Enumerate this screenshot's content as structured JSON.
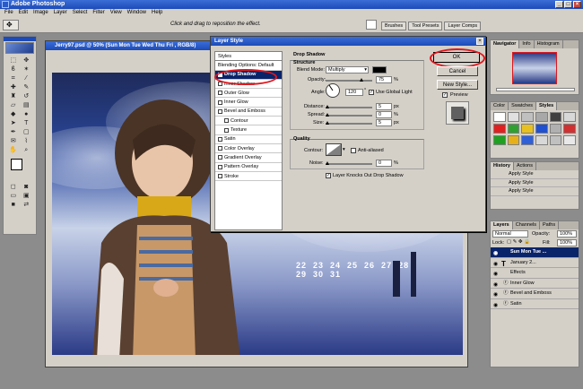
{
  "app": {
    "title": "Adobe Photoshop"
  },
  "menu": [
    "File",
    "Edit",
    "Image",
    "Layer",
    "Select",
    "Filter",
    "View",
    "Window",
    "Help"
  ],
  "options": {
    "hint": "Click and drag to reposition the effect.",
    "wells": [
      "Brushes",
      "Tool Presets",
      "Layer Comps"
    ]
  },
  "document": {
    "title": "Jerry97.psd @ 50% (Sun Mon Tue Wed Thu Fri , RGB/8)"
  },
  "calendar": {
    "row1": "22  23  24  25  26  27  28",
    "row2": "29  30  31"
  },
  "dialog": {
    "title": "Layer Style",
    "styles_header": "Styles",
    "styles": [
      {
        "label": "Blending Options: Default",
        "checked": false,
        "sub": false
      },
      {
        "label": "Drop Shadow",
        "checked": true,
        "sub": false,
        "selected": true
      },
      {
        "label": "Inner Shadow",
        "checked": false,
        "sub": false
      },
      {
        "label": "Outer Glow",
        "checked": false,
        "sub": false
      },
      {
        "label": "Inner Glow",
        "checked": false,
        "sub": false
      },
      {
        "label": "Bevel and Emboss",
        "checked": false,
        "sub": false
      },
      {
        "label": "Contour",
        "checked": false,
        "sub": true
      },
      {
        "label": "Texture",
        "checked": false,
        "sub": true
      },
      {
        "label": "Satin",
        "checked": false,
        "sub": false
      },
      {
        "label": "Color Overlay",
        "checked": false,
        "sub": false
      },
      {
        "label": "Gradient Overlay",
        "checked": false,
        "sub": false
      },
      {
        "label": "Pattern Overlay",
        "checked": false,
        "sub": false
      },
      {
        "label": "Stroke",
        "checked": false,
        "sub": false
      }
    ],
    "section": "Drop Shadow",
    "structure": "Structure",
    "blend_mode_label": "Blend Mode:",
    "blend_mode": "Multiply",
    "opacity_label": "Opacity:",
    "opacity": "75",
    "angle_label": "Angle:",
    "angle": "120",
    "global_light": "Use Global Light",
    "distance_label": "Distance:",
    "distance": "5",
    "spread_label": "Spread:",
    "spread": "0",
    "size_label": "Size:",
    "size": "5",
    "px": "px",
    "pct": "%",
    "quality": "Quality",
    "contour_label": "Contour:",
    "anti_aliased": "Anti-aliased",
    "noise_label": "Noise:",
    "noise": "0",
    "knockout": "Layer Knocks Out Drop Shadow",
    "ok": "OK",
    "cancel": "Cancel",
    "new_style": "New Style...",
    "preview": "Preview",
    "shadow_color": "#000000"
  },
  "navigator": {
    "tabs": [
      "Navigator",
      "Info",
      "Histogram"
    ]
  },
  "styles_panel": {
    "tabs": [
      "Color",
      "Swatches",
      "Styles"
    ]
  },
  "history": {
    "tabs": [
      "History",
      "Actions"
    ],
    "items": [
      "Apply Style",
      "Apply Style",
      "Apply Style"
    ]
  },
  "layers": {
    "tabs": [
      "Layers",
      "Channels",
      "Paths"
    ],
    "mode": "Normal",
    "opacity_label": "Opacity:",
    "opacity": "100%",
    "lock_label": "Lock:",
    "fill_label": "Fill:",
    "fill": "100%",
    "rows": [
      {
        "label": "Sun Mon Tue ...",
        "kind": "text",
        "selected": true
      },
      {
        "label": "January 2...",
        "kind": "text",
        "selected": false
      },
      {
        "label": "Effects",
        "kind": "effects",
        "selected": false
      },
      {
        "label": "Inner Glow",
        "kind": "effect",
        "selected": false
      },
      {
        "label": "Bevel and Emboss",
        "kind": "effect",
        "selected": false
      },
      {
        "label": "Satin",
        "kind": "effect",
        "selected": false
      }
    ]
  },
  "colors": {
    "accent": "#0a246a",
    "highlight": "#e0161c",
    "title": "#1c4bb8"
  }
}
